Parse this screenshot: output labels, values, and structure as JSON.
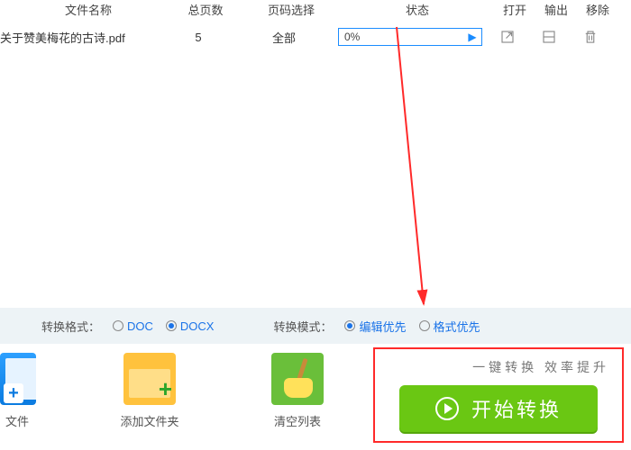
{
  "columns": {
    "c1": "文件名称",
    "c2": "总页数",
    "c3": "页码选择",
    "c4": "状态",
    "c5": "打开",
    "c6": "输出",
    "c7": "移除"
  },
  "row": {
    "filename": "关于赞美梅花的古诗.pdf",
    "pages": "5",
    "pagesel": "全部",
    "progress": "0%"
  },
  "options": {
    "format_label": "转换格式：",
    "format_doc": "DOC",
    "format_docx": "DOCX",
    "mode_label": "转换模式：",
    "mode_edit": "编辑优先",
    "mode_format": "格式优先"
  },
  "tools": {
    "file": "文件",
    "folder": "添加文件夹",
    "clear": "清空列表"
  },
  "action": {
    "caption": "一键转换  效率提升",
    "button": "开始转换"
  }
}
